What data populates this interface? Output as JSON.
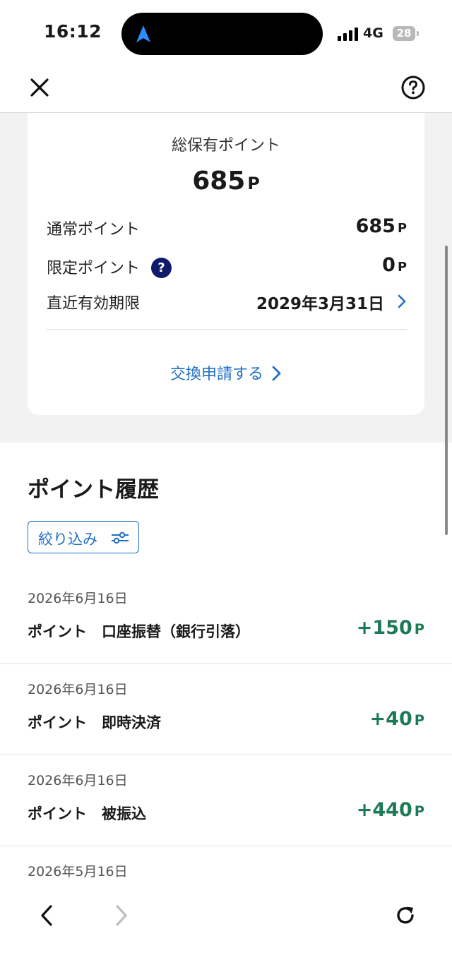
{
  "status_bar": {
    "time": "16:12",
    "network": "4G",
    "battery": "28"
  },
  "card": {
    "total_label": "総保有ポイント",
    "total_value": "685",
    "unit": "P",
    "rows": [
      {
        "label": "通常ポイント",
        "value": "685",
        "unit": "P"
      },
      {
        "label": "限定ポイント",
        "value": "0",
        "unit": "P"
      }
    ],
    "expiry_label": "直近有効期限",
    "expiry_value": "2029年3月31日",
    "exchange_link": "交換申請する"
  },
  "history": {
    "title": "ポイント履歴",
    "filter_label": "絞り込み",
    "items": [
      {
        "date": "2026年6月16日",
        "desc": "ポイント　口座振替（銀行引落）",
        "amount": "+150",
        "unit": "P"
      },
      {
        "date": "2026年6月16日",
        "desc": "ポイント　即時決済",
        "amount": "+40",
        "unit": "P"
      },
      {
        "date": "2026年6月16日",
        "desc": "ポイント　被振込",
        "amount": "+440",
        "unit": "P"
      },
      {
        "date": "2026年5月16日"
      }
    ]
  },
  "colors": {
    "accent": "#1f6fc5",
    "positive": "#1c7a55",
    "help_badge": "#0f1a6b"
  },
  "icons": [
    "close-icon",
    "help-icon",
    "chevron-right-icon",
    "filter-icon",
    "back-icon",
    "forward-icon",
    "reload-icon"
  ]
}
